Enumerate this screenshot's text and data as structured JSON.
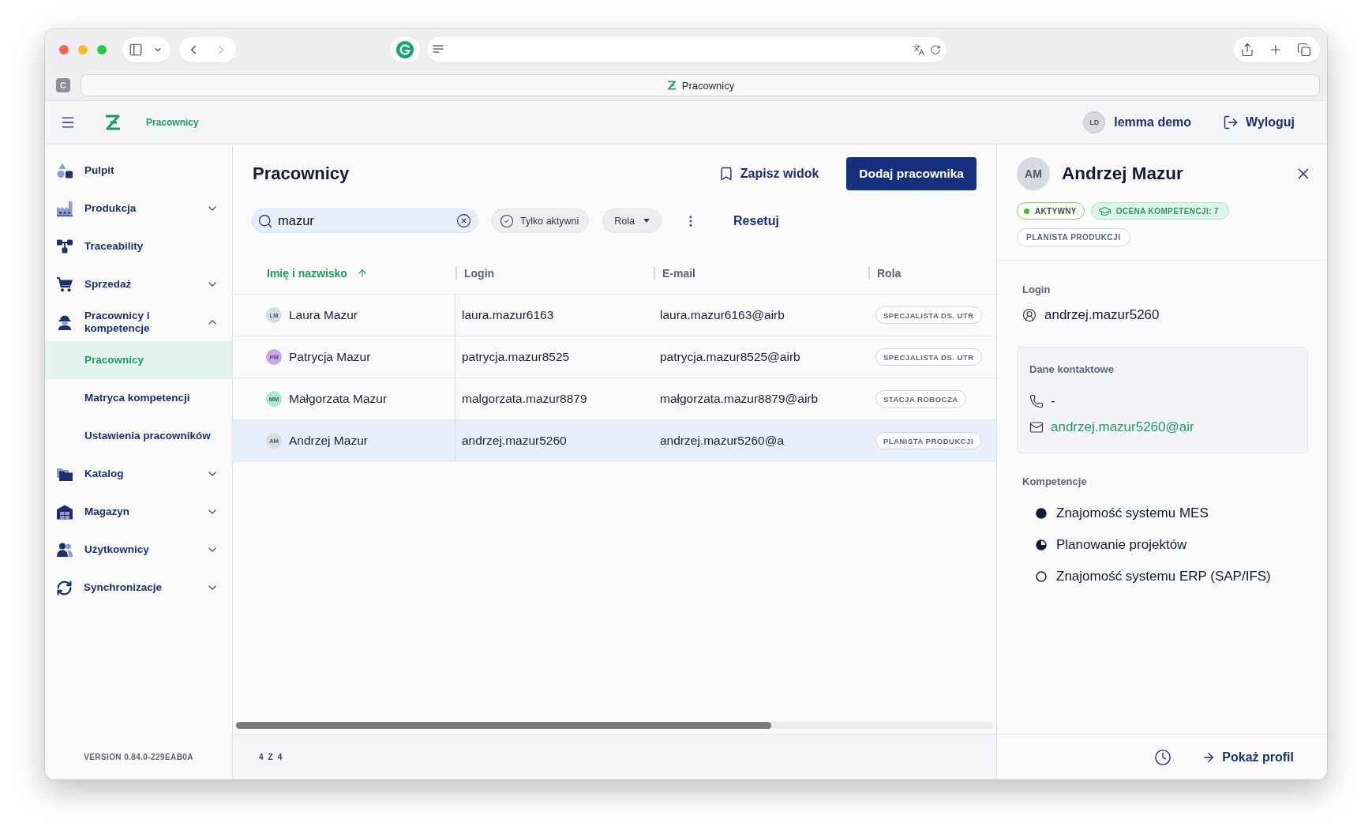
{
  "browser": {
    "profile_badge": "C",
    "tab_title": "Pracownicy"
  },
  "header": {
    "breadcrumb": "Pracownicy",
    "user": {
      "initials": "LD",
      "name": "lemma demo"
    },
    "logout": "Wyloguj"
  },
  "sidebar": {
    "items": [
      {
        "kind": "link",
        "label": "Pulpit",
        "selected": false
      },
      {
        "kind": "group",
        "label": "Produkcja",
        "selected": false,
        "expanded": false
      },
      {
        "kind": "link",
        "label": "Traceability",
        "selected": false
      },
      {
        "kind": "group",
        "label": "Sprzedaż",
        "selected": false,
        "expanded": false
      },
      {
        "kind": "group",
        "label": "Pracownicy i kompetencje",
        "selected": false,
        "expanded": true,
        "children": [
          {
            "label": "Pracownicy",
            "selected": true
          },
          {
            "label": "Matryca kompetencji",
            "selected": false
          },
          {
            "label": "Ustawienia pracowników",
            "selected": false
          }
        ]
      },
      {
        "kind": "group",
        "label": "Katalog",
        "selected": false,
        "expanded": false
      },
      {
        "kind": "group",
        "label": "Magazyn",
        "selected": false,
        "expanded": false
      },
      {
        "kind": "group",
        "label": "Użytkownicy",
        "selected": false,
        "expanded": false
      },
      {
        "kind": "group",
        "label": "Synchronizacje",
        "selected": false,
        "expanded": false
      }
    ],
    "version": "VERSION 0.84.0-229EAB0A"
  },
  "page": {
    "title": "Pracownicy",
    "save_view": "Zapisz widok",
    "add_button": "Dodaj pracownika"
  },
  "filters": {
    "search": {
      "value": "mazur"
    },
    "chips": [
      {
        "kind": "toggle",
        "label": "Tylko aktywni"
      },
      {
        "kind": "dropdown",
        "label": "Rola"
      }
    ],
    "reset": "Resetuj"
  },
  "table": {
    "columns": [
      {
        "label": "Imię i nazwisko",
        "sorted": true
      },
      {
        "label": "Login",
        "sorted": false
      },
      {
        "label": "E-mail",
        "sorted": false
      },
      {
        "label": "Rola",
        "sorted": false
      }
    ],
    "rows": [
      {
        "avatar": {
          "initials": "LM",
          "color": "#d9dbe2"
        },
        "name": "Laura Mazur",
        "login": "laura.mazur6163",
        "email": "laura.mazur6163@airb",
        "role": "SPECJALISTA DS. UTR",
        "selected": false
      },
      {
        "avatar": {
          "initials": "PM",
          "color": "#c9a6ef"
        },
        "name": "Patrycja Mazur",
        "login": "patrycja.mazur8525",
        "email": "patrycja.mazur8525@airb",
        "role": "SPECJALISTA DS. UTR",
        "selected": false
      },
      {
        "avatar": {
          "initials": "MM",
          "color": "#a9e8d8"
        },
        "name": "Małgorzata Mazur",
        "login": "malgorzata.mazur8879",
        "email": "małgorzata.mazur8879@airb",
        "role": "STACJA ROBOCZA",
        "selected": false
      },
      {
        "avatar": {
          "initials": "AM",
          "color": "#d9dbe2"
        },
        "name": "Andrzej Mazur",
        "login": "andrzej.mazur5260",
        "email": "andrzej.mazur5260@a",
        "role": "PLANISTA PRODUKCJI",
        "selected": true
      }
    ],
    "footer": "4 Z 4"
  },
  "detail": {
    "initials": "AM",
    "name": "Andrzej Mazur",
    "badges": [
      {
        "kind": "status",
        "label": "AKTYWNY"
      },
      {
        "kind": "score",
        "label": "OCENA KOMPETENCJI: 7"
      },
      {
        "kind": "role",
        "label": "PLANISTA PRODUKCJI"
      }
    ],
    "login": {
      "label": "Login",
      "value": "andrzej.mazur5260"
    },
    "contact": {
      "title": "Dane kontaktowe",
      "phone": "-",
      "email": "andrzej.mazur5260@air"
    },
    "competences": {
      "title": "Kompetencje",
      "items": [
        {
          "kind": "full",
          "label": "Znajomość systemu MES"
        },
        {
          "kind": "partial",
          "label": "Planowanie projektów"
        },
        {
          "kind": "empty",
          "label": "Znajomość systemu ERP (SAP/IFS)"
        }
      ]
    },
    "profile_link": "Pokaż profil"
  }
}
